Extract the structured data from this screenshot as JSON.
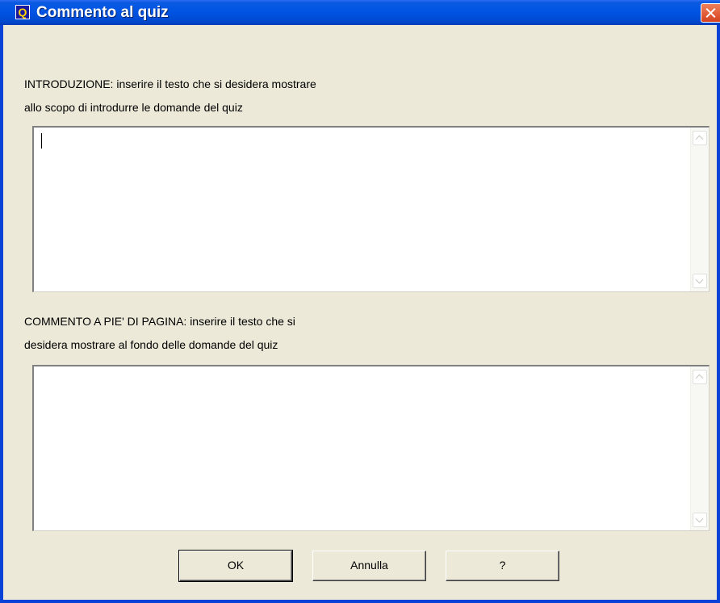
{
  "window": {
    "title": "Commento al quiz",
    "app_icon_letter": "Q"
  },
  "intro": {
    "label_line1": "INTRODUZIONE: inserire il testo che si desidera mostrare",
    "label_line2": "allo scopo di introdurre le domande del quiz",
    "value": ""
  },
  "footer_comment": {
    "label_line1": "COMMENTO A PIE' DI PAGINA: inserire il testo che si",
    "label_line2": "desidera mostrare al fondo delle domande del quiz",
    "value": ""
  },
  "buttons": {
    "ok": "OK",
    "cancel": "Annulla",
    "help": "?"
  },
  "colors": {
    "titlebar": "#0055e5",
    "dialog_bg": "#ece9d8",
    "close_button": "#d6411e"
  }
}
